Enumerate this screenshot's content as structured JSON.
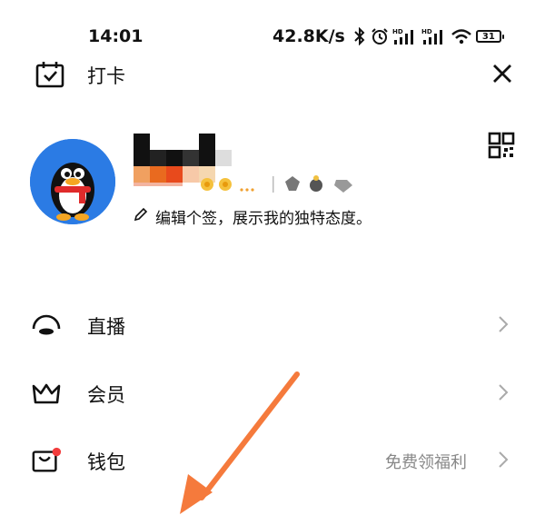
{
  "status_bar": {
    "time": "14:01",
    "net_speed": "42.8K/s",
    "battery": "31",
    "icons": [
      "bluetooth-icon",
      "alarm-icon",
      "signal-hd-icon",
      "signal-hd-icon",
      "wifi-icon",
      "battery-icon"
    ]
  },
  "header": {
    "checkin_label": "打卡",
    "checkin_icon": "calendar-check-icon",
    "close_icon": "close-icon"
  },
  "profile": {
    "avatar_icon": "qq-penguin-avatar",
    "signature": "编辑个签，展示我的独特态度。",
    "signature_icon": "pencil-icon",
    "qr_icon": "qr-code-icon"
  },
  "menu": {
    "items": [
      {
        "label": "直播",
        "icon": "live-icon",
        "extra": ""
      },
      {
        "label": "会员",
        "icon": "crown-icon",
        "extra": ""
      },
      {
        "label": "钱包",
        "icon": "wallet-icon",
        "extra": "免费领福利",
        "badge": true
      }
    ]
  },
  "colors": {
    "avatar_bg": "#2b7be4",
    "badge_red": "#f23c3c",
    "arrow": "#f57a3c",
    "muted": "#888888"
  }
}
